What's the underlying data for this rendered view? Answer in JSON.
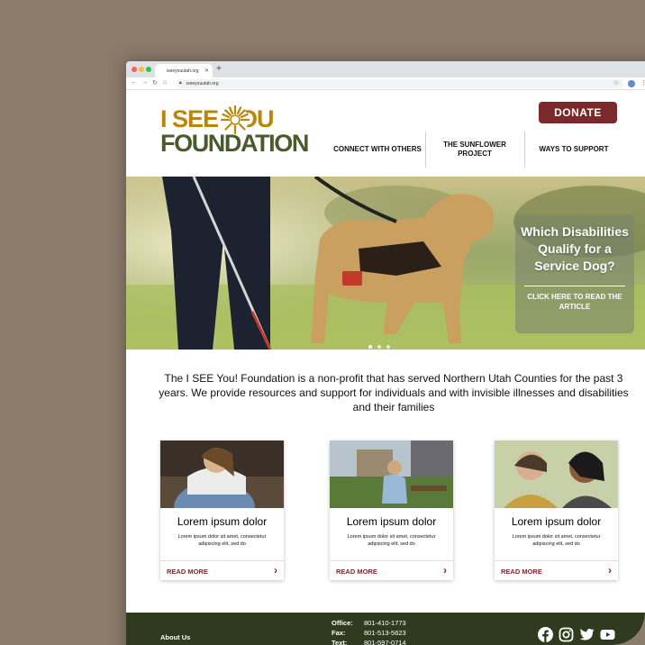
{
  "browser": {
    "tab_title": "iseeyouutah.org",
    "url": "iseeyouutah.org",
    "colors": {
      "close": "#ff5f57",
      "min": "#febc2e",
      "max": "#28c840"
    }
  },
  "site": {
    "logo": {
      "line1": "I SEE YOU",
      "line2": "FOUNDATION"
    },
    "donate_label": "DONATE",
    "menu": [
      {
        "label": "CONNECT WITH OTHERS"
      },
      {
        "label": "THE SUNFLOWER PROJECT"
      },
      {
        "label": "WAYS TO SUPPORT"
      }
    ],
    "hero": {
      "heading": "Which Disabilities Qualify for a Service Dog?",
      "cta": "CLICK HERE TO READ THE ARTICLE"
    },
    "intro": "The I SEE You! Foundation is a non-profit that has served Northern Utah Counties for the past 3 years. We provide resources and support for individuals and with invisible illnesses and disabilities and their families",
    "cards": [
      {
        "title": "Lorem ipsum dolor",
        "text": "Lorem ipsum dolor sit amet, consectetur adipiscing elit, sed do",
        "link": "READ MORE"
      },
      {
        "title": "Lorem ipsum dolor",
        "text": "Lorem ipsum dolor sit amet, consectetur adipiscing elit, sed do",
        "link": "READ MORE"
      },
      {
        "title": "Lorem ipsum dolor",
        "text": "Lorem ipsum dolor sit amet, consectetur adipiscing elit, sed do",
        "link": "READ MORE"
      }
    ],
    "footer": {
      "about": "About Us",
      "contact": [
        {
          "k": "Office:",
          "v": "801-410-1773"
        },
        {
          "k": "Fax:",
          "v": "801-513-5623"
        },
        {
          "k": "Text:",
          "v": "801-597-0714"
        }
      ],
      "social": [
        "facebook-icon",
        "instagram-icon",
        "twitter-icon",
        "youtube-icon"
      ]
    },
    "colors": {
      "brand_red": "#7a2a2a",
      "gold": "#b8860b",
      "olive": "#4a5a2a",
      "footer": "#2f3a1e"
    }
  }
}
